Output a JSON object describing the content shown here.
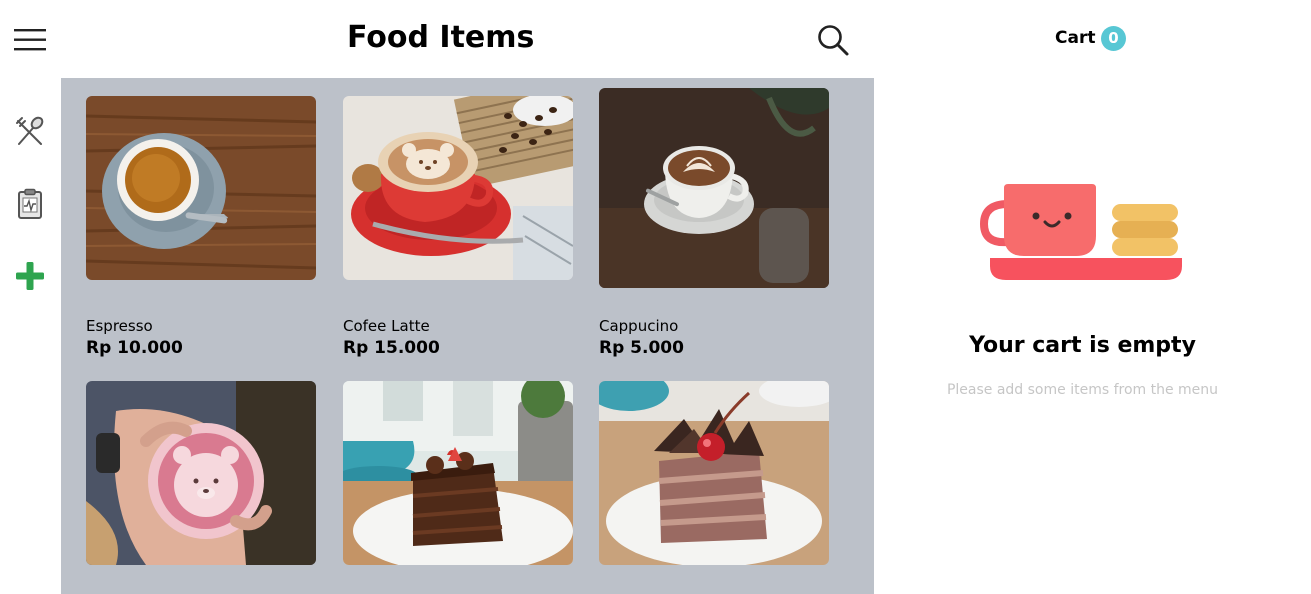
{
  "header": {
    "title": "Food Items"
  },
  "sidebar": {
    "items": [
      {
        "icon": "menu-icon"
      },
      {
        "icon": "fork-spoon-icon"
      },
      {
        "icon": "clipboard-report-icon"
      },
      {
        "icon": "plus-icon"
      }
    ]
  },
  "products": [
    {
      "name": "Espresso",
      "price": "Rp 10.000"
    },
    {
      "name": "Cofee Latte",
      "price": "Rp 15.000"
    },
    {
      "name": "Cappucino",
      "price": "Rp 5.000"
    },
    {
      "name": "",
      "price": ""
    },
    {
      "name": "",
      "price": ""
    },
    {
      "name": "",
      "price": ""
    }
  ],
  "cart": {
    "title": "Cart",
    "count": "0",
    "empty_title": "Your cart is empty",
    "empty_subtitle": "Please add some items from the menu"
  },
  "colors": {
    "grid_bg": "#bcc1c9",
    "accent_green": "#2ea44f",
    "badge": "#57c7d4",
    "cup_red": "#f76c6c",
    "tray": "#f7525e",
    "cookie": "#f2c266"
  }
}
